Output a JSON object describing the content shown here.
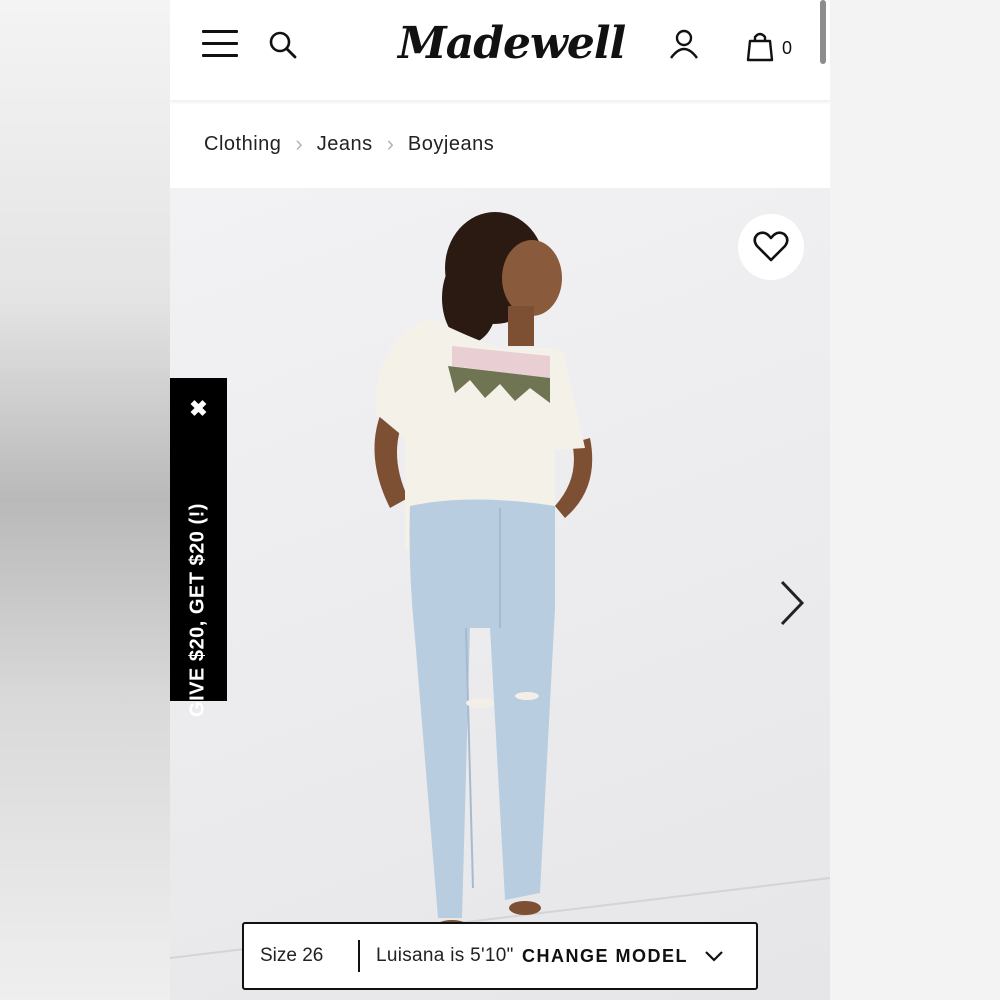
{
  "brand": {
    "logo_text": "Madewell"
  },
  "header": {
    "bag_count": "0"
  },
  "breadcrumb": {
    "items": [
      "Clothing",
      "Jeans",
      "Boyjeans"
    ],
    "separator": "›"
  },
  "referral": {
    "label": "GIVE $20, GET $20 (!)",
    "close_glyph": "✖"
  },
  "model_info": {
    "size": "Size 26",
    "model_desc": "Luisana is 5'10\"",
    "change_label": "CHANGE MODEL"
  },
  "colors": {
    "text": "#111111",
    "background": "#ffffff",
    "referral_bg": "#000000",
    "shirt": "#f4f1e8",
    "jeans": "#b9cde0",
    "trim_green": "#6f7552",
    "trim_pink": "#e9cfd4",
    "skin": "#8a5a3c",
    "hair": "#2a1a12"
  }
}
